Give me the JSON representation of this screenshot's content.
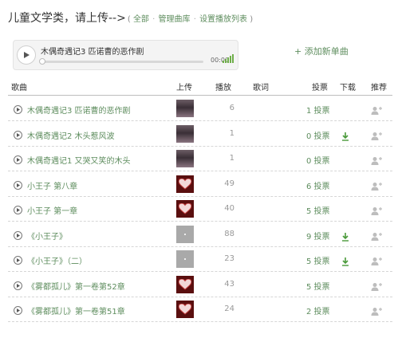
{
  "header": {
    "title": "儿童文学类，请上传-->",
    "open_paren": "(",
    "link_all": "全部",
    "link_manage": "管理曲库",
    "link_playlist": "设置播放列表",
    "close_paren": ")",
    "dot": "·"
  },
  "player": {
    "track_name": "木偶奇遇记3  匹诺曹的恶作剧",
    "time": "00:00",
    "progress": 0
  },
  "add_song_label": "+ 添加新单曲",
  "columns": {
    "song": "歌曲",
    "upload": "上传",
    "plays": "播放",
    "lyrics": "歌词",
    "votes": "投票",
    "download": "下载",
    "recommend": "推荐"
  },
  "rows": [
    {
      "song": "木偶奇遇记3 匹诺曹的恶作剧",
      "avatar": "boy-icon",
      "plays": "6",
      "votes": "1 投票",
      "downloadable": false
    },
    {
      "song": "木偶奇遇记2 木头惹风波",
      "avatar": "boy-icon",
      "plays": "1",
      "votes": "0 投票",
      "downloadable": true
    },
    {
      "song": "木偶奇遇记1 又哭又笑的木头",
      "avatar": "boy-icon",
      "plays": "1",
      "votes": "0 投票",
      "downloadable": false
    },
    {
      "song": "小王子 第八章",
      "avatar": "heart-icon",
      "plays": "49",
      "votes": "6 投票",
      "downloadable": false
    },
    {
      "song": "小王子 第一章",
      "avatar": "heart-icon",
      "plays": "40",
      "votes": "5 投票",
      "downloadable": false
    },
    {
      "song": "《小王子》",
      "avatar": "grey-icon",
      "plays": "88",
      "votes": "9 投票",
      "downloadable": true
    },
    {
      "song": "《小王子》（二）",
      "avatar": "grey-icon",
      "plays": "23",
      "votes": "5 投票",
      "downloadable": true
    },
    {
      "song": "《雾都孤儿》第一卷第52章",
      "avatar": "heart-icon",
      "plays": "43",
      "votes": "5 投票",
      "downloadable": false
    },
    {
      "song": "《雾都孤儿》第一卷第51章",
      "avatar": "heart-icon",
      "plays": "24",
      "votes": "2 投票",
      "downloadable": false
    }
  ],
  "colors": {
    "link_green": "#5e8d5e",
    "download_green": "#4a9a3a",
    "volume_green": "#6fae4a"
  }
}
